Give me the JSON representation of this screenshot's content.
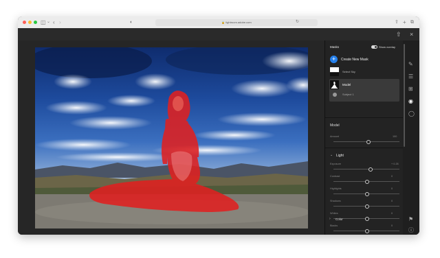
{
  "browser": {
    "url": "lightroom.adobe.com",
    "colors": {
      "close": "#fe5f57",
      "minimize": "#febc2e",
      "zoom": "#28c840"
    }
  },
  "masks_panel": {
    "title": "Masks",
    "overlay_label": "Show overlay",
    "overlay_on": true,
    "create_label": "Create New Mask",
    "items": [
      {
        "label": "Select Sky",
        "selected": false
      },
      {
        "label": "Model",
        "selected": true,
        "sub_label": "Subject 1"
      }
    ]
  },
  "adjust": {
    "mask_name": "Model",
    "amount": {
      "label": "Amount",
      "value": "100"
    },
    "light_section": "Light",
    "light": [
      {
        "label": "Exposure",
        "value": "+ 0.26",
        "level": 0.55
      },
      {
        "label": "Contrast",
        "value": "0",
        "level": 0.5
      },
      {
        "label": "Highlights",
        "value": "0",
        "level": 0.5
      },
      {
        "label": "Shadows",
        "value": "0",
        "level": 0.5
      },
      {
        "label": "Whites",
        "value": "0",
        "level": 0.5
      },
      {
        "label": "Blacks",
        "value": "0",
        "level": 0.5
      }
    ],
    "color_section": "Color"
  },
  "overlay_color": "#e02020"
}
